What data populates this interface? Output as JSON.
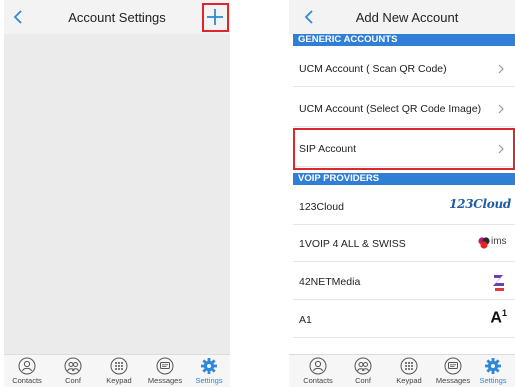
{
  "left_screen": {
    "title": "Account Settings"
  },
  "right_screen": {
    "title": "Add New Account",
    "sections": [
      {
        "label": "GENERIC ACCOUNTS"
      },
      {
        "label": "VOIP PROVIDERS"
      }
    ],
    "generic_accounts": [
      {
        "label": "UCM Account ( Scan QR Code)"
      },
      {
        "label": "UCM Account (Select QR Code Image)"
      },
      {
        "label": "SIP Account"
      }
    ],
    "voip_providers": [
      {
        "label": "123Cloud",
        "logo_text": "123Cloud"
      },
      {
        "label": "1VOIP 4 ALL & SWISS",
        "logo_text": "ims"
      },
      {
        "label": "42NETMedia",
        "logo_text": ""
      },
      {
        "label": "A1",
        "logo_text": "A",
        "logo_sup": "1"
      }
    ]
  },
  "tabbar": {
    "tabs": [
      {
        "label": "Contacts",
        "icon": "contacts-icon"
      },
      {
        "label": "Conf",
        "icon": "conference-icon"
      },
      {
        "label": "Keypad",
        "icon": "keypad-icon"
      },
      {
        "label": "Messages",
        "icon": "messages-icon"
      },
      {
        "label": "Settings",
        "icon": "gear-icon"
      }
    ],
    "active_tab": "Settings"
  },
  "colors": {
    "accent": "#2f89d8",
    "section_bar": "#2f7fd6",
    "highlight": "#e0262a",
    "list_background": "#ebebeb"
  }
}
